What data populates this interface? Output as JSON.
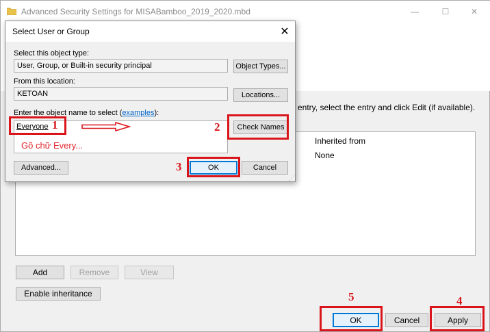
{
  "outer_window": {
    "title": "Advanced Security Settings for MISABamboo_2019_2020.mbd",
    "info_text": "entry, select the entry and click Edit (if available).",
    "column_inherited_from": "Inherited from",
    "row_value": "None",
    "buttons": {
      "add": "Add",
      "remove": "Remove",
      "view": "View",
      "enable_inheritance": "Enable inheritance",
      "ok": "OK",
      "cancel": "Cancel",
      "apply": "Apply"
    },
    "controls": {
      "minimize": "—",
      "maximize": "☐",
      "close": "✕"
    }
  },
  "dialog": {
    "title": "Select User or Group",
    "close_glyph": "✕",
    "object_type_label": "Select this object type:",
    "object_type_value": "User, Group, or Built-in security principal",
    "object_types_button": "Object Types...",
    "location_label": "From this location:",
    "location_value": "KETOAN",
    "locations_button": "Locations...",
    "enter_label_prefix": "Enter the object name to select (",
    "enter_label_link": "examples",
    "enter_label_suffix": "):",
    "names_value": "Everyone",
    "check_names_button": "Check Names",
    "advanced_button": "Advanced...",
    "ok_button": "OK",
    "cancel_button": "Cancel"
  },
  "annotations": {
    "hint": "Gõ chữ Every...",
    "step1": "1",
    "step2": "2",
    "step3": "3",
    "step4": "4",
    "step5": "5",
    "color": "#d9151b"
  }
}
